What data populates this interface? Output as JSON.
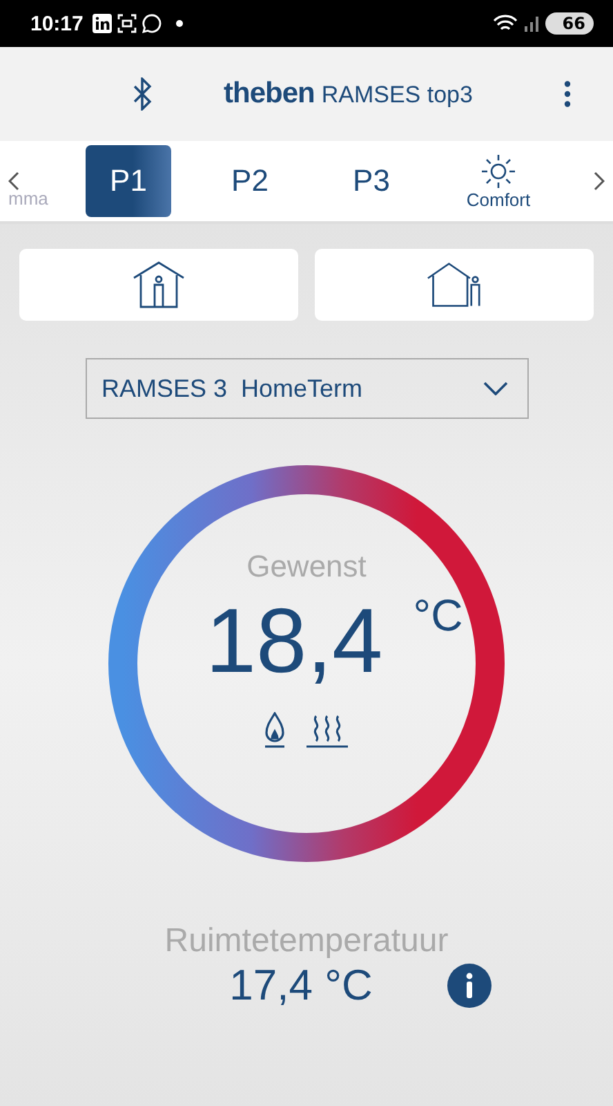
{
  "status_bar": {
    "time": "10:17",
    "battery": "66"
  },
  "header": {
    "brand": "theben",
    "product": "RAMSES top3"
  },
  "tabs": [
    {
      "kind": "text",
      "label": "mma",
      "selected": false,
      "partial": true
    },
    {
      "kind": "text",
      "label": "P1",
      "selected": true
    },
    {
      "kind": "text",
      "label": "P2",
      "selected": false
    },
    {
      "kind": "text",
      "label": "P3",
      "selected": false
    },
    {
      "kind": "sun",
      "label": "Comfort",
      "selected": false
    }
  ],
  "presence_buttons": [
    {
      "kind": "inside"
    },
    {
      "kind": "outside"
    }
  ],
  "device_select": {
    "value": "RAMSES 3  HomeTerm"
  },
  "setpoint": {
    "label": "Gewenst",
    "value": "18,4",
    "unit": "°C",
    "burner_on": true,
    "heating_on": true
  },
  "room": {
    "label": "Ruimtetemperatuur",
    "value": "17,4 °C"
  }
}
